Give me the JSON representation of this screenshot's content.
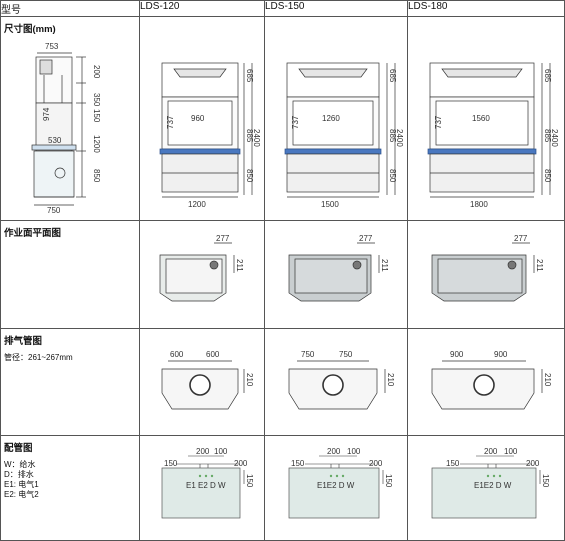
{
  "header": {
    "model_label": "型号",
    "models": [
      "LDS-120",
      "LDS-150",
      "LDS-180"
    ]
  },
  "rows": {
    "dimensions": {
      "label": "尺寸图(mm)",
      "side": {
        "top_width": "753",
        "top_depth": "200",
        "h_top": "350",
        "h_mid": "150",
        "h_total": "1200",
        "h_low": "850",
        "inner_h": "974",
        "inner_w": "530",
        "base_w": "750"
      }
    },
    "worksurface": {
      "label": "作业面平面图"
    },
    "exhaust": {
      "label": "排气管图",
      "sub": "管径：261~267mm"
    },
    "piping": {
      "label": "配管图",
      "legend": [
        "W：给水",
        "D：排水",
        "E1: 电气1",
        "E2: 电气2"
      ]
    }
  },
  "models": [
    {
      "name": "LDS-120",
      "front_inner": "960",
      "front_w": "1200",
      "h_685": "685",
      "h_885": "885",
      "h_2400": "2400",
      "h_737": "737",
      "h_850": "850",
      "ws_277": "277",
      "ws_211": "211",
      "ex_a": "600",
      "ex_b": "600",
      "ex_210": "210",
      "p_200": "200",
      "p_100": "100",
      "p_150": "150",
      "p_200b": "200",
      "p_150v": "150",
      "p_labels": "E1 E2 D W"
    },
    {
      "name": "LDS-150",
      "front_inner": "1260",
      "front_w": "1500",
      "h_685": "685",
      "h_885": "885",
      "h_2400": "2400",
      "h_737": "737",
      "h_850": "850",
      "ws_277": "277",
      "ws_211": "211",
      "ex_a": "750",
      "ex_b": "750",
      "ex_210": "210",
      "p_200": "200",
      "p_100": "100",
      "p_150": "150",
      "p_200b": "200",
      "p_150v": "150",
      "p_labels": "E1E2 D W"
    },
    {
      "name": "LDS-180",
      "front_inner": "1560",
      "front_w": "1800",
      "h_685": "685",
      "h_885": "885",
      "h_2400": "2400",
      "h_737": "737",
      "h_850": "850",
      "ws_277": "277",
      "ws_211": "211",
      "ex_a": "900",
      "ex_b": "900",
      "ex_210": "210",
      "p_200": "200",
      "p_100": "100",
      "p_150": "150",
      "p_200b": "200",
      "p_150v": "150",
      "p_labels": "E1E2 D W"
    }
  ]
}
